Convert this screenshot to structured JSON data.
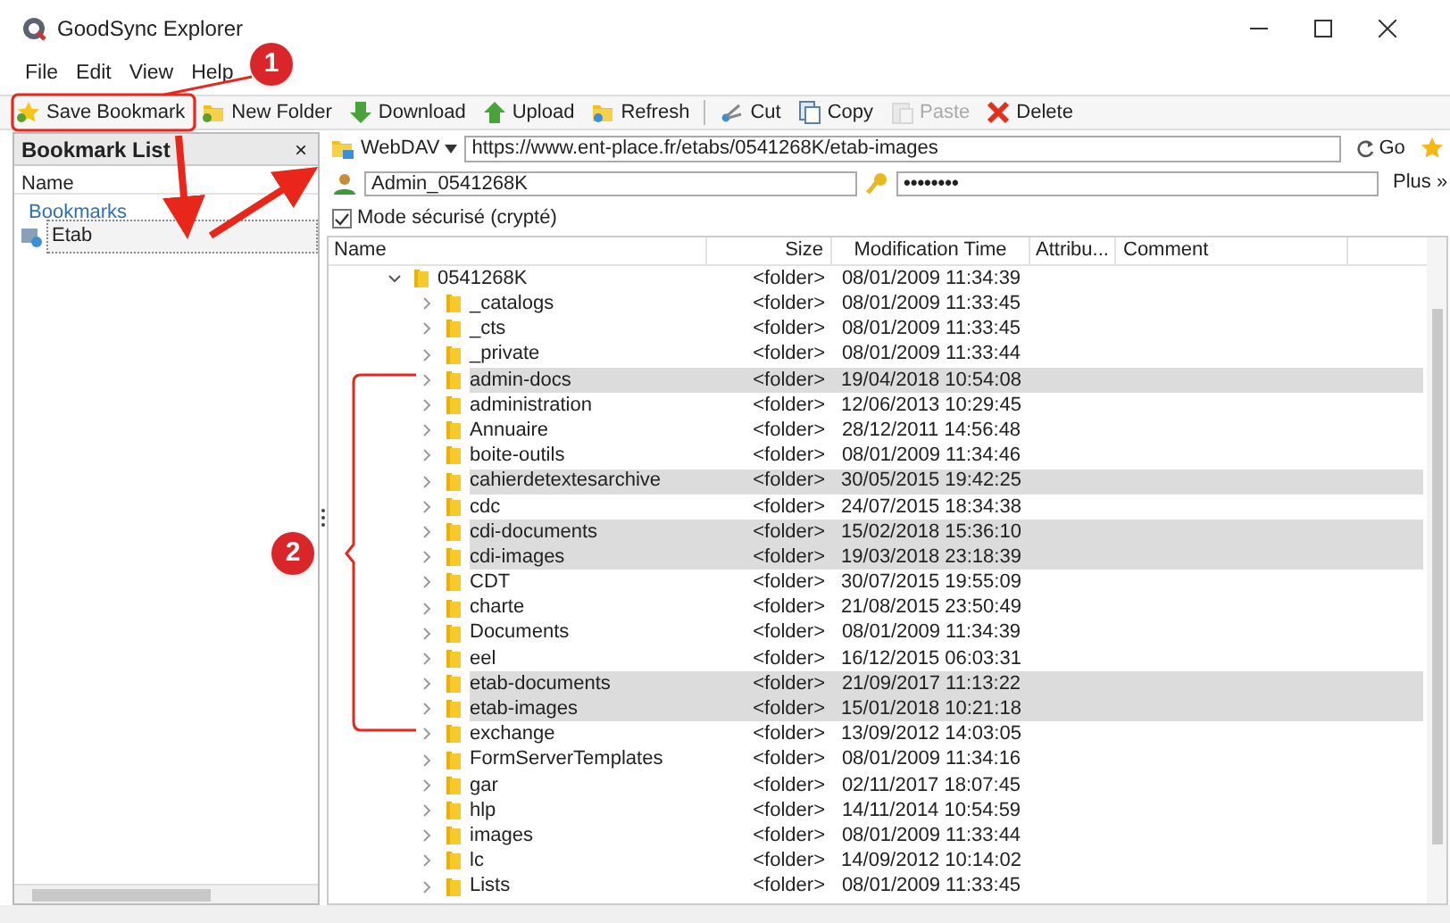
{
  "window": {
    "title": "GoodSync Explorer"
  },
  "menu": [
    "File",
    "Edit",
    "View",
    "Help"
  ],
  "toolbar": [
    {
      "label": "Save Bookmark",
      "disabled": false
    },
    {
      "label": "New Folder",
      "disabled": false
    },
    {
      "label": "Download",
      "disabled": false
    },
    {
      "label": "Upload",
      "disabled": false
    },
    {
      "label": "Refresh",
      "disabled": false
    },
    {
      "label": "Cut",
      "disabled": false
    },
    {
      "label": "Copy",
      "disabled": false
    },
    {
      "label": "Paste",
      "disabled": true
    },
    {
      "label": "Delete",
      "disabled": false
    }
  ],
  "bookmark_panel": {
    "title": "Bookmark List",
    "close": "×",
    "column": "Name",
    "group": "Bookmarks",
    "items": [
      {
        "label": "Etab",
        "selected": true
      }
    ]
  },
  "address_bar": {
    "protocol": "WebDAV",
    "url": "https://www.ent-place.fr/etabs/0541268K/etab-images",
    "go": "Go"
  },
  "login": {
    "username": "Admin_0541268K",
    "password": "••••••••",
    "more": "Plus »"
  },
  "secure_mode": {
    "label": "Mode sécurisé (crypté)",
    "checked": true
  },
  "table": {
    "columns": [
      "Name",
      "Size",
      "Modification Time",
      "Attribu...",
      "Comment"
    ],
    "tree": [
      {
        "name": "0541268K",
        "size": "<folder>",
        "time": "08/01/2009 11:34:39",
        "expanded": true,
        "selected": false,
        "children": [
          {
            "name": "_catalogs",
            "size": "<folder>",
            "time": "08/01/2009 11:33:45",
            "expanded": false,
            "selected": false
          },
          {
            "name": "_cts",
            "size": "<folder>",
            "time": "08/01/2009 11:33:45",
            "expanded": false,
            "selected": false
          },
          {
            "name": "_private",
            "size": "<folder>",
            "time": "08/01/2009 11:33:44",
            "expanded": false,
            "selected": false
          },
          {
            "name": "admin-docs",
            "size": "<folder>",
            "time": "19/04/2018 10:54:08",
            "expanded": false,
            "selected": true
          },
          {
            "name": "administration",
            "size": "<folder>",
            "time": "12/06/2013 10:29:45",
            "expanded": false,
            "selected": false
          },
          {
            "name": "Annuaire",
            "size": "<folder>",
            "time": "28/12/2011 14:56:48",
            "expanded": false,
            "selected": false
          },
          {
            "name": "boite-outils",
            "size": "<folder>",
            "time": "08/01/2009 11:34:46",
            "expanded": false,
            "selected": false
          },
          {
            "name": "cahierdetextesarchive",
            "size": "<folder>",
            "time": "30/05/2015 19:42:25",
            "expanded": false,
            "selected": true
          },
          {
            "name": "cdc",
            "size": "<folder>",
            "time": "24/07/2015 18:34:38",
            "expanded": false,
            "selected": false
          },
          {
            "name": "cdi-documents",
            "size": "<folder>",
            "time": "15/02/2018 15:36:10",
            "expanded": false,
            "selected": true
          },
          {
            "name": "cdi-images",
            "size": "<folder>",
            "time": "19/03/2018 23:18:39",
            "expanded": false,
            "selected": true
          },
          {
            "name": "CDT",
            "size": "<folder>",
            "time": "30/07/2015 19:55:09",
            "expanded": false,
            "selected": false
          },
          {
            "name": "charte",
            "size": "<folder>",
            "time": "21/08/2015 23:50:49",
            "expanded": false,
            "selected": false
          },
          {
            "name": "Documents",
            "size": "<folder>",
            "time": "08/01/2009 11:34:39",
            "expanded": false,
            "selected": false
          },
          {
            "name": "eel",
            "size": "<folder>",
            "time": "16/12/2015 06:03:31",
            "expanded": false,
            "selected": false
          },
          {
            "name": "etab-documents",
            "size": "<folder>",
            "time": "21/09/2017 11:13:22",
            "expanded": false,
            "selected": true
          },
          {
            "name": "etab-images",
            "size": "<folder>",
            "time": "15/01/2018 10:21:18",
            "expanded": false,
            "selected": true
          },
          {
            "name": "exchange",
            "size": "<folder>",
            "time": "13/09/2012 14:03:05",
            "expanded": false,
            "selected": false
          },
          {
            "name": "FormServerTemplates",
            "size": "<folder>",
            "time": "08/01/2009 11:34:16",
            "expanded": false,
            "selected": false
          },
          {
            "name": "gar",
            "size": "<folder>",
            "time": "02/11/2017 18:07:45",
            "expanded": false,
            "selected": false
          },
          {
            "name": "hlp",
            "size": "<folder>",
            "time": "14/11/2014 10:54:59",
            "expanded": false,
            "selected": false
          },
          {
            "name": "images",
            "size": "<folder>",
            "time": "08/01/2009 11:33:44",
            "expanded": false,
            "selected": false
          },
          {
            "name": "lc",
            "size": "<folder>",
            "time": "14/09/2012 10:14:02",
            "expanded": false,
            "selected": false
          },
          {
            "name": "Lists",
            "size": "<folder>",
            "time": "08/01/2009 11:33:45",
            "expanded": false,
            "selected": false
          }
        ]
      }
    ]
  },
  "callouts": [
    {
      "label": "1"
    },
    {
      "label": "2"
    }
  ]
}
